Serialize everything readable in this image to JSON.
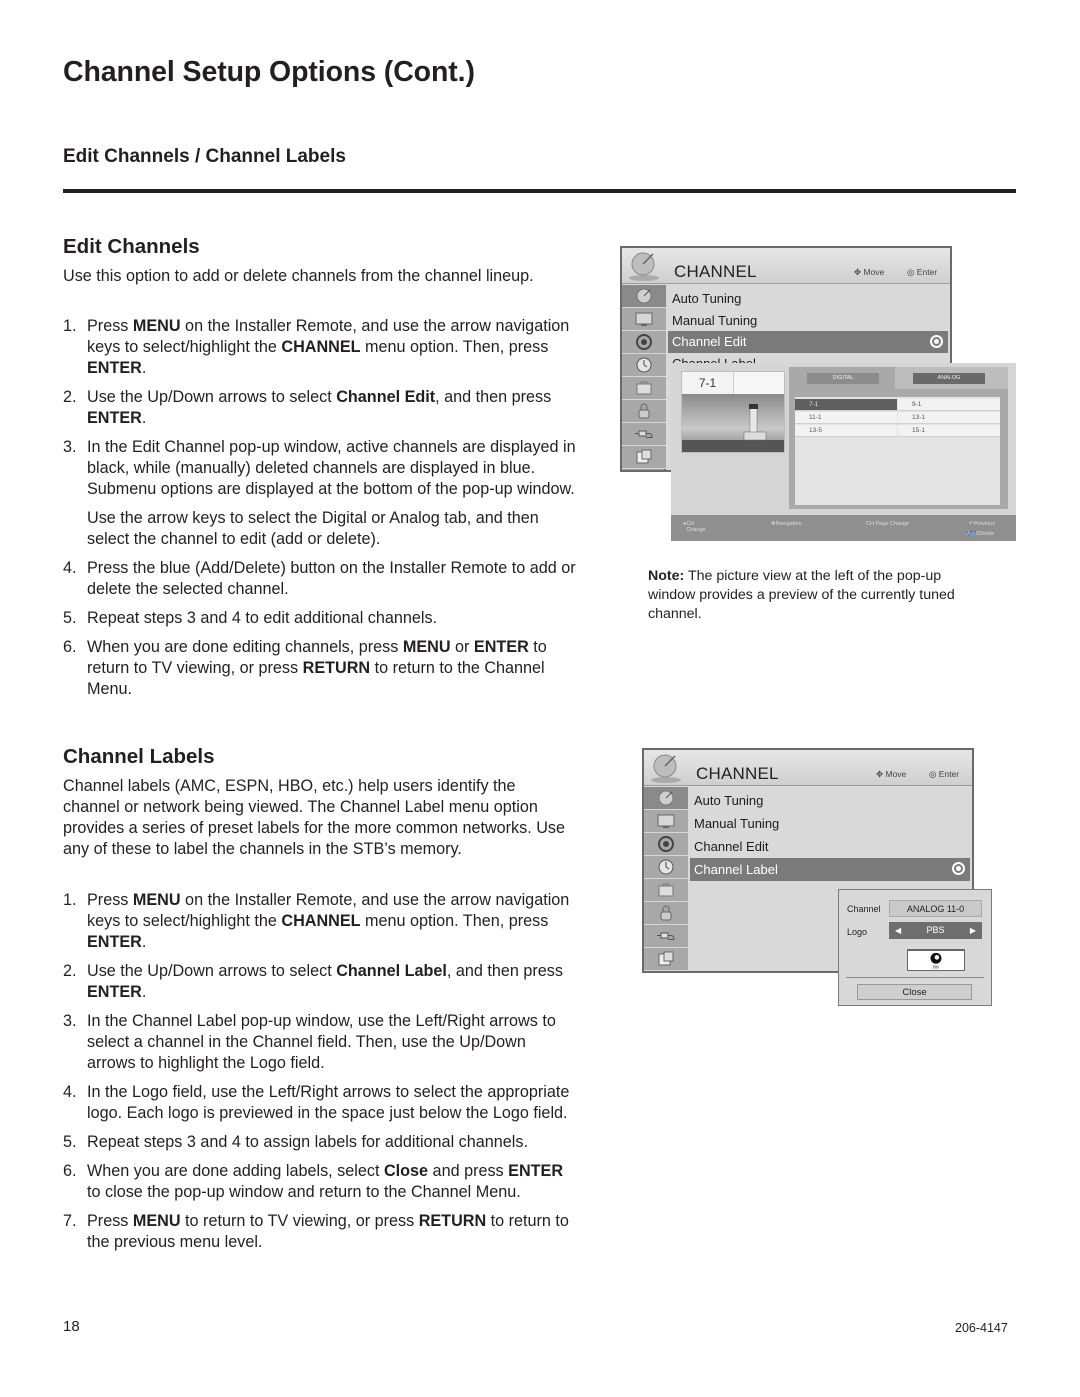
{
  "page": {
    "title": "Channel Setup Options (Cont.)",
    "section_title": "Edit Channels / Channel Labels",
    "page_number": "18",
    "doc_number": "206-4147"
  },
  "edit_channels": {
    "heading": "Edit Channels",
    "intro": "Use this option to add or delete channels from the channel lineup.",
    "steps": [
      {
        "num": "1.",
        "html": "Press <b>MENU</b> on the Installer Remote, and use the arrow navigation keys to select/highlight the <b>CHANNEL</b> menu option. Then, press <b>ENTER</b>."
      },
      {
        "num": "2.",
        "html": "Use the Up/Down arrows to select <b>Channel Edit</b>, and then press <b>ENTER</b>."
      },
      {
        "num": "3.",
        "html": "In the Edit Channel pop-up window, active channels are displayed in black, while (manually) deleted channels are displayed in blue. Submenu options are displayed at the bottom of the pop-up window.",
        "sub": "Use the arrow keys to select the Digital or Analog tab, and then select the channel to edit (add or delete)."
      },
      {
        "num": "4.",
        "html": "Press the blue (Add/Delete) button on the Installer Remote to add or delete the selected channel."
      },
      {
        "num": "5.",
        "html": "Repeat steps 3 and 4 to edit additional channels."
      },
      {
        "num": "6.",
        "html": "When you are done editing channels, press <b>MENU</b> or <b>ENTER</b> to return to TV viewing, or press <b>RETURN</b> to return to the Channel Menu."
      }
    ],
    "note_label": "Note:",
    "note_text": " The picture view at the left of the pop-up window provides a preview of the currently tuned channel."
  },
  "channel_labels": {
    "heading": "Channel Labels",
    "intro": "Channel labels (AMC, ESPN, HBO, etc.) help users identify the channel or network being viewed. The Channel Label menu option provides a series of preset labels for the more common networks. Use any of these to label the channels in the STB’s memory.",
    "steps": [
      {
        "num": "1.",
        "html": "Press <b>MENU</b> on the Installer Remote, and use the arrow navigation keys to select/highlight the <b>CHANNEL</b> menu option. Then, press <b>ENTER</b>."
      },
      {
        "num": "2.",
        "html": "Use the Up/Down arrows to select <b>Channel Label</b>, and then press <b>ENTER</b>."
      },
      {
        "num": "3.",
        "html": "In the Channel Label pop-up window, use the Left/Right arrows to select a channel in the Channel field. Then, use the Up/Down arrows to highlight the Logo field."
      },
      {
        "num": "4.",
        "html": "In the Logo field, use the Left/Right arrows to select the appropriate logo. Each logo is previewed in the space just below the Logo field."
      },
      {
        "num": "5.",
        "html": "Repeat steps 3 and 4 to assign labels for additional channels."
      },
      {
        "num": "6.",
        "html": "When you are done adding labels, select <b>Close</b> and press <b>ENTER</b> to close the pop-up window and return to the Channel Menu."
      },
      {
        "num": "7.",
        "html": "Press <b>MENU</b> to return to TV viewing, or press <b>RETURN</b> to return to the previous menu level."
      }
    ]
  },
  "tv_menu_1": {
    "title": "CHANNEL",
    "hint_move": "Move",
    "hint_enter": "Enter",
    "items": [
      "Auto Tuning",
      "Manual Tuning",
      "Channel Edit",
      "Channel Label"
    ],
    "selected_index": 2,
    "sidebar_icons": [
      "satellite-icon",
      "tv-icon",
      "gear-icon",
      "clock-icon",
      "briefcase-icon",
      "lock-icon",
      "cable-icon",
      "media-icon"
    ],
    "popup": {
      "preview_channel": "7-1",
      "tabs": [
        "DIGITAL",
        "ANALOG"
      ],
      "active_tab": "ANALOG",
      "channels": [
        [
          "7-1",
          "9-1"
        ],
        [
          "11-1",
          "13-1"
        ],
        [
          "13-5",
          "15-1"
        ]
      ],
      "highlighted_channel": "7-1",
      "footer": {
        "ch_change": "CH Change",
        "navigation": "Navigation",
        "page_change": "CH Page Change",
        "previous": "Previous",
        "add_delete": "Add/Delete"
      }
    }
  },
  "tv_menu_2": {
    "title": "CHANNEL",
    "hint_move": "Move",
    "hint_enter": "Enter",
    "items": [
      "Auto Tuning",
      "Manual Tuning",
      "Channel Edit",
      "Channel Label"
    ],
    "selected_index": 3,
    "popup": {
      "channel_label": "Channel",
      "channel_value": "ANALOG 11-0",
      "logo_label": "Logo",
      "logo_value": "PBS",
      "logo_preview_text": "PBS",
      "close_label": "Close"
    }
  }
}
